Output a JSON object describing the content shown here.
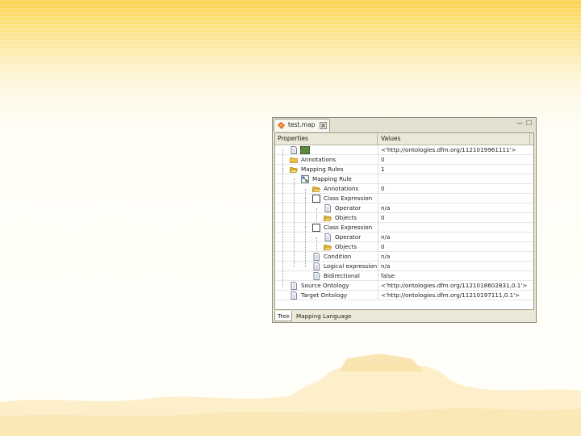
{
  "window": {
    "tab_title": "test.map",
    "minimize_glyph": "—",
    "maximize_glyph": "☐"
  },
  "columns": {
    "properties": "Properties",
    "values": "Values"
  },
  "rows": [
    {
      "label": "",
      "value": "<'http://ontologies.dfm.org/1121019961111'>",
      "icon": "document-icon",
      "expander": ""
    },
    {
      "label": "Annotations",
      "value": "0",
      "icon": "folder-icon",
      "expander": ""
    },
    {
      "label": "Mapping Rules",
      "value": "1",
      "icon": "folder-open-icon",
      "expander": "–"
    },
    {
      "label": "Mapping Rule",
      "value": "",
      "icon": "rule-icon",
      "expander": "–"
    },
    {
      "label": "Annotations",
      "value": "0",
      "icon": "folder-icon",
      "expander": ""
    },
    {
      "label": "Class Expression",
      "value": "",
      "icon": "class-icon",
      "expander": "–"
    },
    {
      "label": "Operator",
      "value": "n/a",
      "icon": "document-icon",
      "expander": ""
    },
    {
      "label": "Objects",
      "value": "0",
      "icon": "folder-icon",
      "expander": ""
    },
    {
      "label": "Class Expression",
      "value": "",
      "icon": "class-icon",
      "expander": "–"
    },
    {
      "label": "Operator",
      "value": "n/a",
      "icon": "document-icon",
      "expander": ""
    },
    {
      "label": "Objects",
      "value": "0",
      "icon": "folder-icon",
      "expander": ""
    },
    {
      "label": "Condition",
      "value": "n/a",
      "icon": "document-icon",
      "expander": ""
    },
    {
      "label": "Logical expression",
      "value": "n/a",
      "icon": "document-icon",
      "expander": ""
    },
    {
      "label": "Bidirectional",
      "value": "false",
      "icon": "document-icon",
      "expander": ""
    },
    {
      "label": "Source Ontology",
      "value": "<'http://ontologies.dfm.org/1121018602831,0.1'>",
      "icon": "document-icon",
      "expander": ""
    },
    {
      "label": "Target Ontology",
      "value": "<'http://ontologies.dfm.org/11210197111,0.1'>",
      "icon": "document-icon",
      "expander": ""
    }
  ],
  "bottom_tabs": {
    "tree": "Tree",
    "mapping_language": "Mapping Language"
  },
  "colors": {
    "folder": "#f0c040",
    "accent": "#5b8a3a"
  }
}
